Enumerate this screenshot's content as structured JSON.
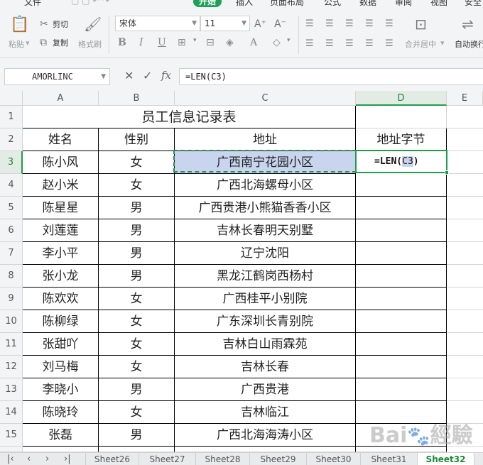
{
  "ribbon": {
    "tabs": [
      "文件",
      "开始",
      "插入",
      "页面布局",
      "公式",
      "数据",
      "审阅",
      "视图",
      "安全"
    ],
    "active_tab": "开始",
    "paste_label": "粘贴",
    "cut_label": "剪切",
    "copy_label": "复制",
    "format_painter_label": "格式刷",
    "font_name": "宋体",
    "font_size": "11",
    "merge_center_label": "合并居中",
    "wrap_label": "自动换行"
  },
  "formula_bar": {
    "name_box": "AMORLINC",
    "fx_label": "fx",
    "formula": "=LEN(C3)"
  },
  "columns": [
    "A",
    "B",
    "C",
    "D",
    "E"
  ],
  "rows": [
    "1",
    "2",
    "3",
    "4",
    "5",
    "6",
    "7",
    "8",
    "9",
    "10",
    "11",
    "12",
    "13",
    "14",
    "15"
  ],
  "sheet": {
    "title": "员工信息记录表",
    "headers": [
      "姓名",
      "性别",
      "地址",
      "地址字节"
    ],
    "records": [
      [
        "陈小风",
        "女",
        "广西南宁花园小区"
      ],
      [
        "赵小米",
        "女",
        "广西北海螺母小区"
      ],
      [
        "陈星星",
        "男",
        "广西贵港小熊猫香香小区"
      ],
      [
        "刘莲莲",
        "男",
        "吉林长春明天别墅"
      ],
      [
        "李小平",
        "男",
        "辽宁沈阳"
      ],
      [
        "张小龙",
        "男",
        "黑龙江鹤岗西杨村"
      ],
      [
        "陈欢欢",
        "女",
        "广西桂平小别院"
      ],
      [
        "陈柳绿",
        "女",
        "广东深圳长青别院"
      ],
      [
        "张甜吖",
        "女",
        "吉林白山雨霖苑"
      ],
      [
        "刘马梅",
        "女",
        "吉林长春"
      ],
      [
        "李晓小",
        "男",
        "广西贵港"
      ],
      [
        "陈晓玲",
        "女",
        "吉林临江"
      ],
      [
        "张磊",
        "男",
        "广西北海海涛小区"
      ]
    ],
    "editing_cell": {
      "prefix": "=LEN(",
      "ref": "C3",
      "suffix": ")"
    }
  },
  "sheet_tabs": [
    "Sheet26",
    "Sheet27",
    "Sheet28",
    "Sheet29",
    "Sheet30",
    "Sheet31",
    "Sheet32"
  ],
  "active_sheet": "Sheet32",
  "watermark": "Bai du 经验",
  "colors": {
    "accent_green": "#1ea157",
    "selection_blue": "#c9d5ee"
  }
}
